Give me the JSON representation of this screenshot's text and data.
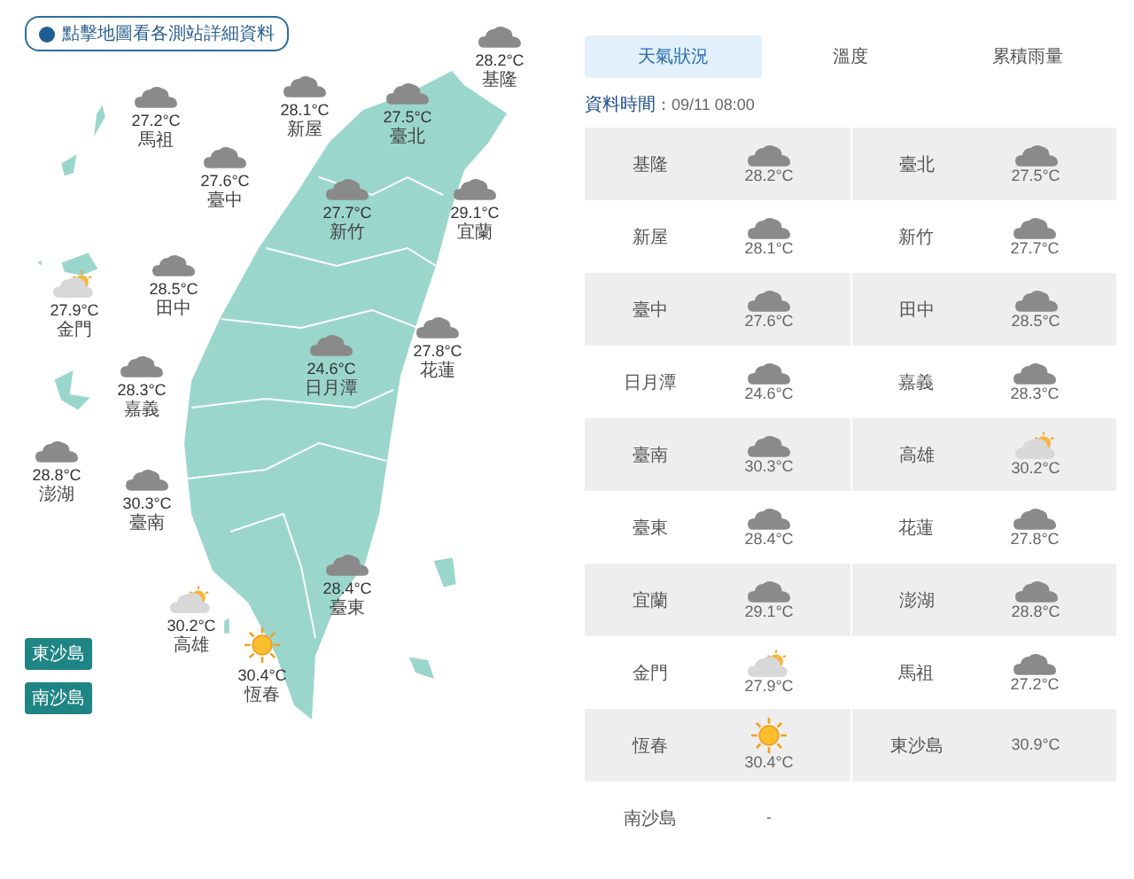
{
  "notice": "點擊地圖看各測站詳細資料",
  "map_stations": [
    {
      "name": "基隆",
      "temp": "28.2°C",
      "kind": "cloudy"
    },
    {
      "name": "馬祖",
      "temp": "27.2°C",
      "kind": "cloudy"
    },
    {
      "name": "新屋",
      "temp": "28.1°C",
      "kind": "cloudy"
    },
    {
      "name": "臺北",
      "temp": "27.5°C",
      "kind": "cloudy"
    },
    {
      "name": "臺中",
      "temp": "27.6°C",
      "kind": "cloudy"
    },
    {
      "name": "新竹",
      "temp": "27.7°C",
      "kind": "cloudy"
    },
    {
      "name": "宜蘭",
      "temp": "29.1°C",
      "kind": "cloudy"
    },
    {
      "name": "田中",
      "temp": "28.5°C",
      "kind": "cloudy"
    },
    {
      "name": "金門",
      "temp": "27.9°C",
      "kind": "suncloud"
    },
    {
      "name": "花蓮",
      "temp": "27.8°C",
      "kind": "cloudy"
    },
    {
      "name": "日月潭",
      "temp": "24.6°C",
      "kind": "cloudy"
    },
    {
      "name": "嘉義",
      "temp": "28.3°C",
      "kind": "cloudy"
    },
    {
      "name": "澎湖",
      "temp": "28.8°C",
      "kind": "cloudy"
    },
    {
      "name": "臺南",
      "temp": "30.3°C",
      "kind": "cloudy"
    },
    {
      "name": "臺東",
      "temp": "28.4°C",
      "kind": "cloudy"
    },
    {
      "name": "高雄",
      "temp": "30.2°C",
      "kind": "suncloud"
    },
    {
      "name": "恆春",
      "temp": "30.4°C",
      "kind": "sunny"
    }
  ],
  "island_buttons": [
    "東沙島",
    "南沙島"
  ],
  "tabs": [
    {
      "label": "天氣狀況",
      "selected": true
    },
    {
      "label": "溫度",
      "selected": false
    },
    {
      "label": "累積雨量",
      "selected": false
    }
  ],
  "update_time": {
    "label": "資料時間",
    "value": "：09/11 08:00"
  },
  "table_rows": [
    [
      {
        "name": "基隆",
        "temp": "28.2°C",
        "kind": "cloudy"
      },
      {
        "name": "臺北",
        "temp": "27.5°C",
        "kind": "cloudy"
      }
    ],
    [
      {
        "name": "新屋",
        "temp": "28.1°C",
        "kind": "cloudy"
      },
      {
        "name": "新竹",
        "temp": "27.7°C",
        "kind": "cloudy"
      }
    ],
    [
      {
        "name": "臺中",
        "temp": "27.6°C",
        "kind": "cloudy"
      },
      {
        "name": "田中",
        "temp": "28.5°C",
        "kind": "cloudy"
      }
    ],
    [
      {
        "name": "日月潭",
        "temp": "24.6°C",
        "kind": "cloudy"
      },
      {
        "name": "嘉義",
        "temp": "28.3°C",
        "kind": "cloudy"
      }
    ],
    [
      {
        "name": "臺南",
        "temp": "30.3°C",
        "kind": "cloudy"
      },
      {
        "name": "高雄",
        "temp": "30.2°C",
        "kind": "suncloud"
      }
    ],
    [
      {
        "name": "臺東",
        "temp": "28.4°C",
        "kind": "cloudy"
      },
      {
        "name": "花蓮",
        "temp": "27.8°C",
        "kind": "cloudy"
      }
    ],
    [
      {
        "name": "宜蘭",
        "temp": "29.1°C",
        "kind": "cloudy"
      },
      {
        "name": "澎湖",
        "temp": "28.8°C",
        "kind": "cloudy"
      }
    ],
    [
      {
        "name": "金門",
        "temp": "27.9°C",
        "kind": "suncloud"
      },
      {
        "name": "馬祖",
        "temp": "27.2°C",
        "kind": "cloudy"
      }
    ],
    [
      {
        "name": "恆春",
        "temp": "30.4°C",
        "kind": "sunny"
      },
      {
        "name": "東沙島",
        "temp": "30.9°C",
        "kind": "plain"
      }
    ],
    [
      {
        "name": "南沙島",
        "temp": "-",
        "kind": "plain"
      }
    ]
  ]
}
